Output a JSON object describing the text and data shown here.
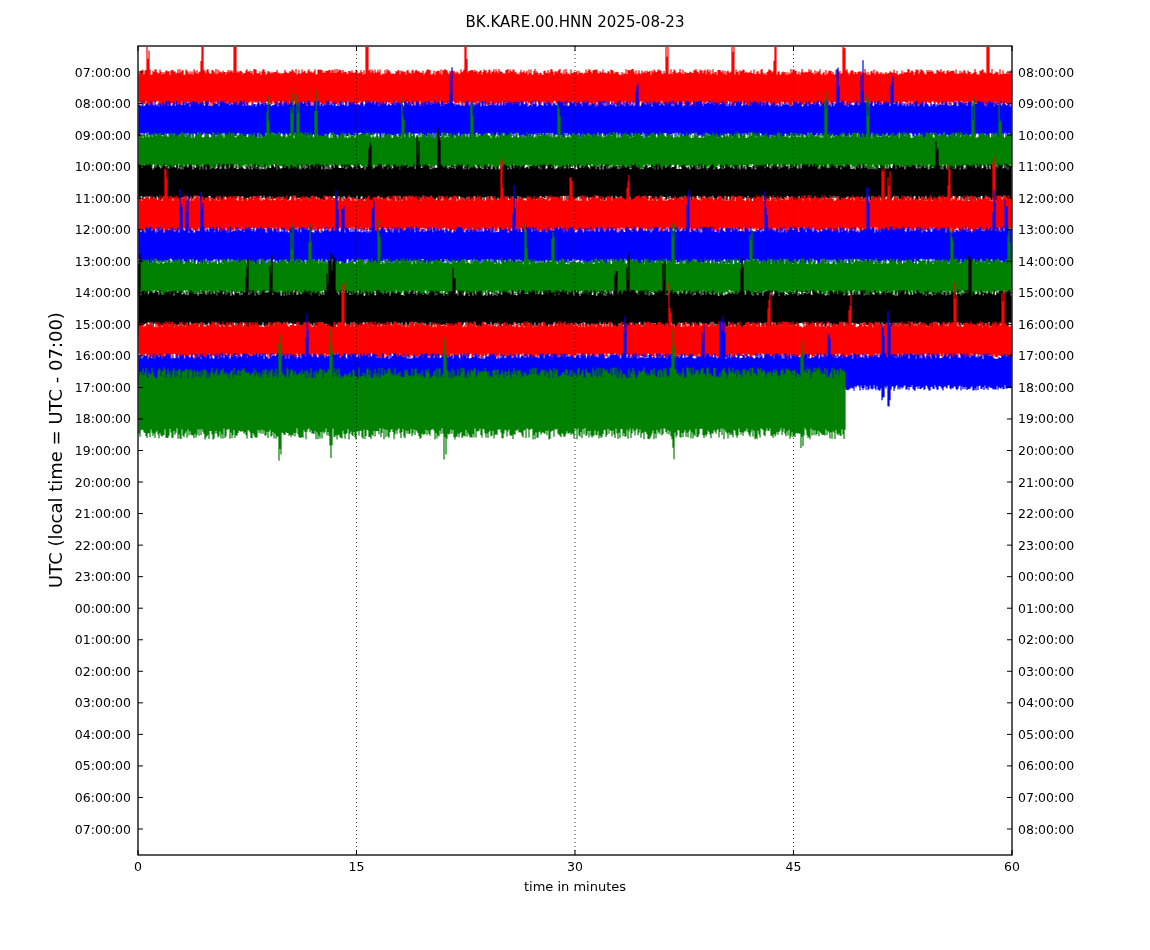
{
  "title": "BK.KARE.00.HNN 2025-08-23",
  "y_label": "UTC (local time = UTC - 07:00)",
  "x_label": "time in minutes",
  "left_ticks": [
    "07:00:00",
    "08:00:00",
    "09:00:00",
    "10:00:00",
    "11:00:00",
    "12:00:00",
    "13:00:00",
    "14:00:00",
    "15:00:00",
    "16:00:00",
    "17:00:00",
    "18:00:00",
    "19:00:00",
    "20:00:00",
    "21:00:00",
    "22:00:00",
    "23:00:00",
    "00:00:00",
    "01:00:00",
    "02:00:00",
    "03:00:00",
    "04:00:00",
    "05:00:00",
    "06:00:00",
    "07:00:00"
  ],
  "right_ticks": [
    "08:00:00",
    "09:00:00",
    "10:00:00",
    "11:00:00",
    "12:00:00",
    "13:00:00",
    "14:00:00",
    "15:00:00",
    "16:00:00",
    "17:00:00",
    "18:00:00",
    "19:00:00",
    "20:00:00",
    "21:00:00",
    "22:00:00",
    "23:00:00",
    "00:00:00",
    "01:00:00",
    "02:00:00",
    "03:00:00",
    "04:00:00",
    "05:00:00",
    "06:00:00",
    "07:00:00",
    "08:00:00"
  ],
  "x_ticks": [
    "0",
    "15",
    "30",
    "45",
    "60"
  ],
  "traces": [
    {
      "kind": "full",
      "color": "#ff0000"
    },
    {
      "kind": "full",
      "color": "#0000ff"
    },
    {
      "kind": "full",
      "color": "#008000"
    },
    {
      "kind": "full",
      "color": "#000000"
    },
    {
      "kind": "full",
      "color": "#ff0000"
    },
    {
      "kind": "full",
      "color": "#0000ff"
    },
    {
      "kind": "full",
      "color": "#008000"
    },
    {
      "kind": "full",
      "color": "#000000"
    },
    {
      "kind": "full",
      "color": "#ff0000"
    },
    {
      "kind": "full",
      "color": "#0000ff"
    },
    {
      "kind": "partial",
      "color": "#008000"
    }
  ]
}
